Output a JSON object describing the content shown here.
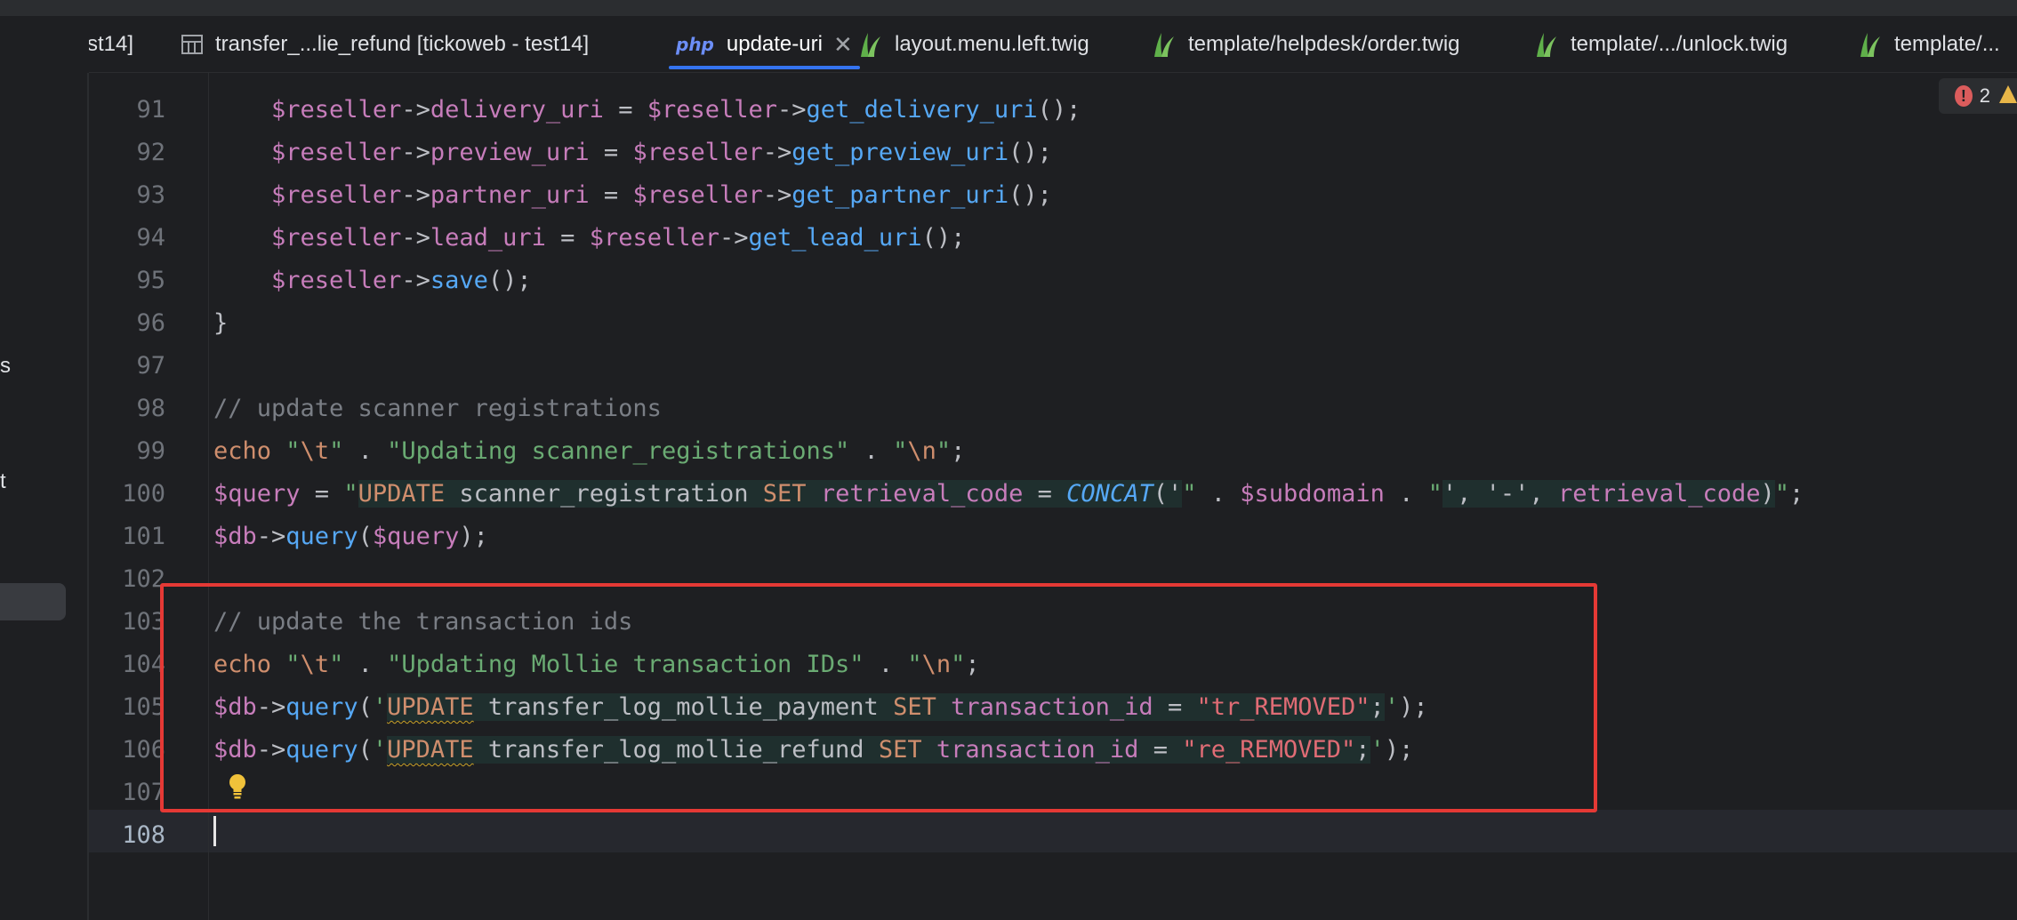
{
  "left_panel": {
    "fragments": [
      "s",
      "t"
    ]
  },
  "tabs": [
    {
      "label": "st14]",
      "icon": "none"
    },
    {
      "label": "transfer_...lie_refund [tickoweb - test14]",
      "icon": "table-icon"
    },
    {
      "label": "update-uri",
      "icon": "php-icon",
      "icon_text": "php",
      "active": true
    },
    {
      "label": "layout.menu.left.twig",
      "icon": "twig-icon"
    },
    {
      "label": "template/helpdesk/order.twig",
      "icon": "twig-icon"
    },
    {
      "label": "template/.../unlock.twig",
      "icon": "twig-icon"
    },
    {
      "label": "template/...",
      "icon": "twig-icon"
    }
  ],
  "inspection": {
    "error_count": "2",
    "error_glyph": "!"
  },
  "colors": {
    "accent": "#3574f0",
    "highlight_box": "#e53935",
    "error": "#db5c5c",
    "warning": "#e8b648"
  },
  "lines": [
    {
      "n": "91",
      "text": "    $reseller->delivery_uri = $reseller->get_delivery_uri();"
    },
    {
      "n": "92",
      "text": "    $reseller->preview_uri = $reseller->get_preview_uri();"
    },
    {
      "n": "93",
      "text": "    $reseller->partner_uri = $reseller->get_partner_uri();"
    },
    {
      "n": "94",
      "text": "    $reseller->lead_uri = $reseller->get_lead_uri();"
    },
    {
      "n": "95",
      "text": "    $reseller->save();"
    },
    {
      "n": "96",
      "text": "}"
    },
    {
      "n": "97",
      "text": ""
    },
    {
      "n": "98",
      "text": "// update scanner registrations"
    },
    {
      "n": "99",
      "text": "echo \"\\t\" . \"Updating scanner_registrations\" . \"\\n\";"
    },
    {
      "n": "100",
      "text": "$query = \"UPDATE scanner_registration SET retrieval_code = CONCAT('\" . $subdomain . \"', '-', retrieval_code)\";"
    },
    {
      "n": "101",
      "text": "$db->query($query);"
    },
    {
      "n": "102",
      "text": ""
    },
    {
      "n": "103",
      "text": "// update the transaction ids"
    },
    {
      "n": "104",
      "text": "echo \"\\t\" . \"Updating Mollie transaction IDs\" . \"\\n\";"
    },
    {
      "n": "105",
      "text": "$db->query('UPDATE transfer_log_mollie_payment SET transaction_id = \"tr_REMOVED\";');"
    },
    {
      "n": "106",
      "text": "$db->query('UPDATE transfer_log_mollie_refund SET transaction_id = \"re_REMOVED\";');"
    },
    {
      "n": "107",
      "text": ""
    },
    {
      "n": "108",
      "text": ""
    }
  ]
}
